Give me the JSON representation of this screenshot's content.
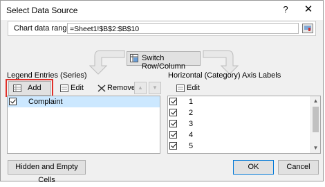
{
  "dialog": {
    "title": "Select Data Source",
    "help_symbol": "?",
    "close_symbol": "✕"
  },
  "range": {
    "label": "Chart data range:",
    "value": "=Sheet1!$B$2:$B$10"
  },
  "switch_button": "Switch Row/Column",
  "legend": {
    "label": "Legend Entries (Series)",
    "add": "Add",
    "edit": "Edit",
    "remove": "Remove",
    "up_symbol": "▲",
    "down_symbol": "▼",
    "items": [
      {
        "label": "Complaint",
        "checked": true
      }
    ]
  },
  "axis": {
    "label": "Horizontal (Category) Axis Labels",
    "edit": "Edit",
    "items": [
      {
        "label": "1",
        "checked": true
      },
      {
        "label": "2",
        "checked": true
      },
      {
        "label": "3",
        "checked": true
      },
      {
        "label": "4",
        "checked": true
      },
      {
        "label": "5",
        "checked": true
      }
    ]
  },
  "footer": {
    "hidden_empty": "Hidden and Empty Cells",
    "ok": "OK",
    "cancel": "Cancel"
  },
  "colors": {
    "highlight": "#e0302a",
    "selected_row": "#cce8ff"
  }
}
